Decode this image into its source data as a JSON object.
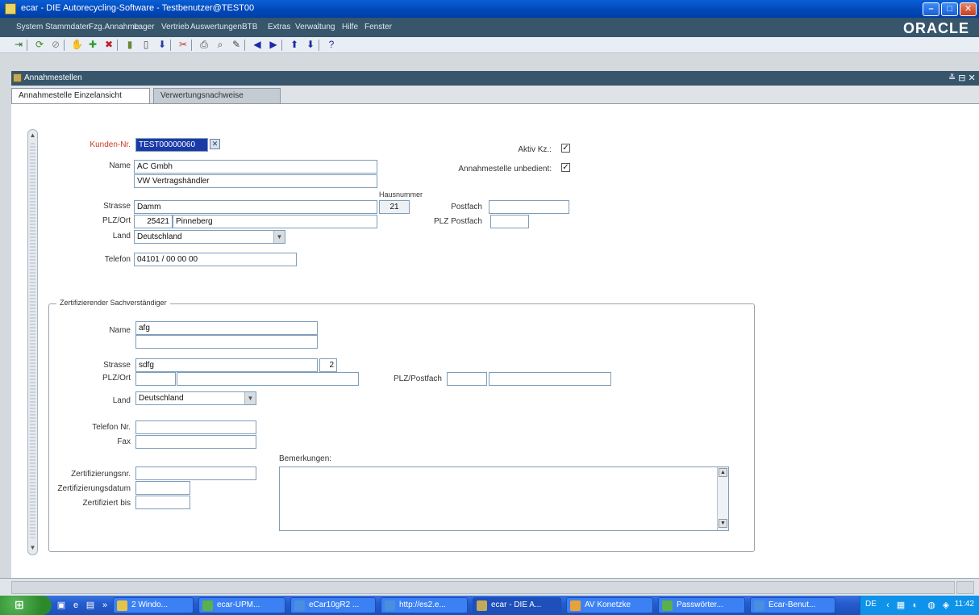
{
  "window": {
    "title": "ecar - DIE Autorecycling-Software - Testbenutzer@TEST00",
    "min": "–",
    "max": "□",
    "close": "✕"
  },
  "menu": {
    "items": [
      "System",
      "Stammdaten",
      "Fzg.Annahme",
      "Lager",
      "Vertrieb",
      "Auswertungen",
      "BTB",
      "Extras",
      "Verwaltung",
      "Hilfe",
      "Fenster"
    ],
    "brand": "ORACLE"
  },
  "toolbar": {
    "icons": [
      {
        "name": "exit-icon",
        "glyph": "⇥",
        "color": "#3a6f2a"
      },
      {
        "name": "refresh-icon",
        "glyph": "⟳",
        "color": "#3a8a2a"
      },
      {
        "name": "cancel-query-icon",
        "glyph": "⊘",
        "color": "#888888"
      },
      {
        "name": "query-icon",
        "glyph": "✋",
        "color": "#c0902a"
      },
      {
        "name": "insert-record-icon",
        "glyph": "✚",
        "color": "#2a9a2a"
      },
      {
        "name": "delete-record-icon",
        "glyph": "✖",
        "color": "#c0202a"
      },
      {
        "name": "duplicate-icon",
        "glyph": "▮",
        "color": "#6a8a3a"
      },
      {
        "name": "clear-icon",
        "glyph": "▯",
        "color": "#555555"
      },
      {
        "name": "down-icon",
        "glyph": "⬇",
        "color": "#2a3aa8"
      },
      {
        "name": "tools-icon",
        "glyph": "✂",
        "color": "#c03a2a"
      },
      {
        "name": "print-icon",
        "glyph": "⎙",
        "color": "#444444"
      },
      {
        "name": "search-icon",
        "glyph": "⌕",
        "color": "#444444"
      },
      {
        "name": "edit-icon",
        "glyph": "✎",
        "color": "#444444"
      },
      {
        "name": "prev-record-icon",
        "glyph": "◀",
        "color": "#1a2aa8"
      },
      {
        "name": "next-record-icon",
        "glyph": "▶",
        "color": "#1a2aa8"
      },
      {
        "name": "prev-block-icon",
        "glyph": "⬆",
        "color": "#1a2aa8"
      },
      {
        "name": "next-block-icon",
        "glyph": "⬇",
        "color": "#1a2aa8"
      },
      {
        "name": "help-icon",
        "glyph": "?",
        "color": "#1a2aa8"
      }
    ]
  },
  "inner": {
    "title": "Annahmestellen",
    "controls": "≚ ⊟ ✕"
  },
  "tabs": [
    {
      "label": "Annahmestelle Einzelansicht"
    },
    {
      "label": "Verwertungsnachweise"
    }
  ],
  "form": {
    "kunden_label": "Kunden-Nr.",
    "kunden_value": "TEST00000060",
    "lov": "✕",
    "name_label": "Name",
    "name1": "AC Gmbh",
    "name2": "VW Vertragshändler",
    "hausnummer_label": "Hausnummer",
    "strasse_label": "Strasse",
    "strasse": "Damm",
    "hausnummer": "21",
    "plzort_label": "PLZ/Ort",
    "plz": "25421",
    "ort": "Pinneberg",
    "land_label": "Land",
    "land": "Deutschland",
    "telefon_label": "Telefon",
    "telefon": "04101 / 00 00 00",
    "aktiv_label": "Aktiv Kz.:",
    "aktiv_check": "✓",
    "annahmestelle_label": "Annahmestelle unbedient:",
    "annahmestelle_check": "✓",
    "postfach_label": "Postfach",
    "postfach": "",
    "plzpostfach_label": "PLZ Postfach",
    "plzpostfach": ""
  },
  "sv": {
    "group_title": "Zertifizierender Sachverständiger",
    "name_label": "Name",
    "name1": "afg",
    "name2": "",
    "strasse_label": "Strasse",
    "strasse": "sdfg",
    "hausnummer": "2",
    "plzort_label": "PLZ/Ort",
    "plz": "",
    "ort": "",
    "plzpostfach_label": "PLZ/Postfach",
    "plzpostfach_plz": "",
    "plzpostfach_fach": "",
    "land_label": "Land",
    "land": "Deutschland",
    "telefon_label": "Telefon Nr.",
    "telefon": "",
    "fax_label": "Fax",
    "fax": "",
    "bemerkungen_label": "Bemerkungen:",
    "zertnr_label": "Zertifizierungsnr.",
    "zertnr": "",
    "zertdatum_label": "Zertifizierungsdatum",
    "zertdatum": "",
    "zertbis_label": "Zertifiziert bis",
    "zertbis": ""
  },
  "taskbar": {
    "tasks": [
      {
        "label": "2 Windo...",
        "color": "#e7c24a"
      },
      {
        "label": "ecar-UPM...",
        "color": "#5ab04a"
      },
      {
        "label": "eCar10gR2 ...",
        "color": "#4a8ee0"
      },
      {
        "label": "http://es2.e...",
        "color": "#4a8ee0"
      },
      {
        "label": "ecar - DIE A...",
        "color": "#c2a95a"
      },
      {
        "label": "AV Konetzke",
        "color": "#e7a23a"
      },
      {
        "label": "Passwörter...",
        "color": "#5ab04a"
      },
      {
        "label": "Ecar-Benut...",
        "color": "#4a8ee0"
      }
    ],
    "lang": "DE",
    "clock": "11:42"
  }
}
